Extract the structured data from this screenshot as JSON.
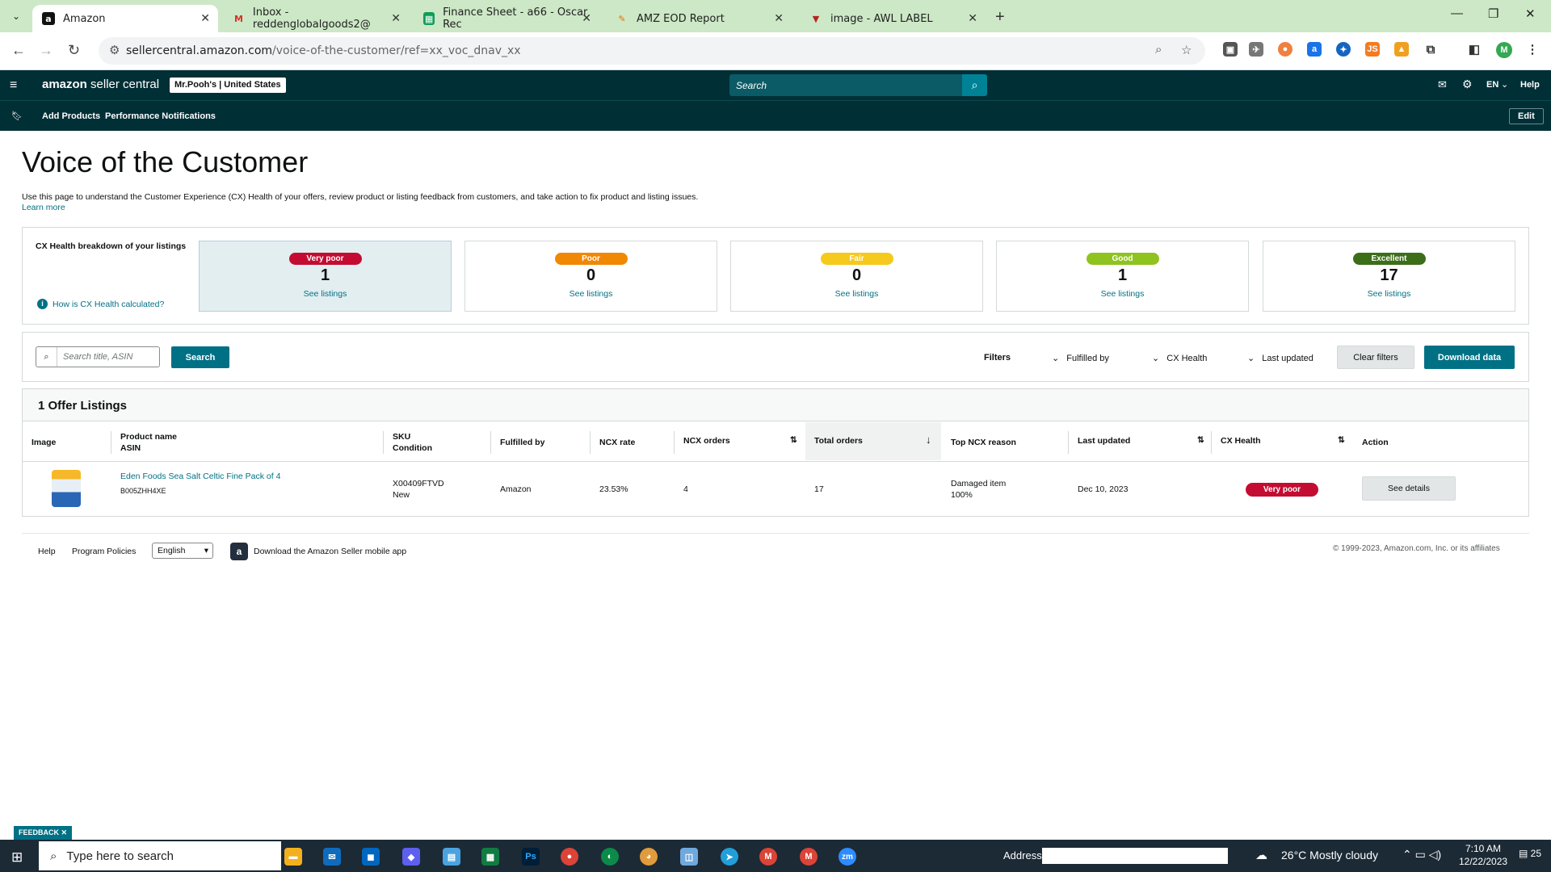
{
  "browser": {
    "tabs": [
      {
        "title": "Amazon",
        "icon": "amazon-icon"
      },
      {
        "title": "Inbox - reddenglobalgoods2@",
        "icon": "gmail-icon"
      },
      {
        "title": "Finance Sheet - a66 - Oscar Rec",
        "icon": "sheets-icon"
      },
      {
        "title": "AMZ EOD Report",
        "icon": "report-icon"
      },
      {
        "title": "image - AWL LABEL",
        "icon": "image-icon"
      }
    ],
    "url_host": "sellercentral.amazon.com",
    "url_path": "/voice-of-the-customer/ref=xx_voc_dnav_xx",
    "profile_initial": "M"
  },
  "header": {
    "logo_a": "amazon",
    "logo_b": " seller central",
    "store": "Mr.Pooh's | United States",
    "search_placeholder": "Search",
    "lang": "EN",
    "help": "Help",
    "nav": [
      "Add Products",
      "Performance Notifications"
    ],
    "edit": "Edit"
  },
  "page": {
    "title": "Voice of the Customer",
    "intro": "Use this page to understand the Customer Experience (CX) Health of your offers, review product or listing feedback from customers, and take action to fix product and listing issues.",
    "learn_more": "Learn more"
  },
  "cx": {
    "label": "CX Health breakdown of your listings",
    "how": "How is CX Health calculated?",
    "cards": [
      {
        "status": "Very poor",
        "count": "1",
        "link": "See listings",
        "color": "#c40c32"
      },
      {
        "status": "Poor",
        "count": "0",
        "link": "See listings",
        "color": "#f08804"
      },
      {
        "status": "Fair",
        "count": "0",
        "link": "See listings",
        "color": "#f6c91d"
      },
      {
        "status": "Good",
        "count": "1",
        "link": "See listings",
        "color": "#8fc31f"
      },
      {
        "status": "Excellent",
        "count": "17",
        "link": "See listings",
        "color": "#3c6e1a"
      }
    ]
  },
  "filters": {
    "search_placeholder": "Search title, ASIN",
    "search_btn": "Search",
    "label": "Filters",
    "fulfilled_by": "Fulfilled by",
    "cx_health": "CX Health",
    "last_updated": "Last updated",
    "clear": "Clear filters",
    "download": "Download data"
  },
  "table": {
    "heading": "1 Offer Listings",
    "headers": {
      "image": "Image",
      "product": "Product name",
      "asin": "ASIN",
      "sku": "SKU",
      "condition": "Condition",
      "fulfilled": "Fulfilled by",
      "ncx_rate": "NCX rate",
      "ncx_orders": "NCX orders",
      "total_orders": "Total orders",
      "top_reason": "Top NCX reason",
      "last_updated": "Last updated",
      "cx_health": "CX Health",
      "action": "Action"
    },
    "rows": [
      {
        "product": "Eden Foods Sea Salt Celtic Fine Pack of 4",
        "asin": "B005ZHH4XE",
        "sku": "X00409FTVD",
        "condition": "New",
        "fulfilled": "Amazon",
        "ncx_rate": "23.53%",
        "ncx_orders": "4",
        "total_orders": "17",
        "reason": "Damaged item",
        "reason_pct": "100%",
        "updated": "Dec 10, 2023",
        "health": "Very poor",
        "action": "See details"
      }
    ]
  },
  "footer": {
    "help": "Help",
    "policies": "Program Policies",
    "language": "English",
    "app": "Download the Amazon Seller mobile app",
    "copyright": "© 1999-2023, Amazon.com, Inc. or its affiliates",
    "feedback": "FEEDBACK"
  },
  "taskbar": {
    "search": "Type here to search",
    "address_label": "Address",
    "weather": "26°C  Mostly cloudy",
    "time": "7:10 AM",
    "date": "12/22/2023",
    "notif": "25"
  }
}
